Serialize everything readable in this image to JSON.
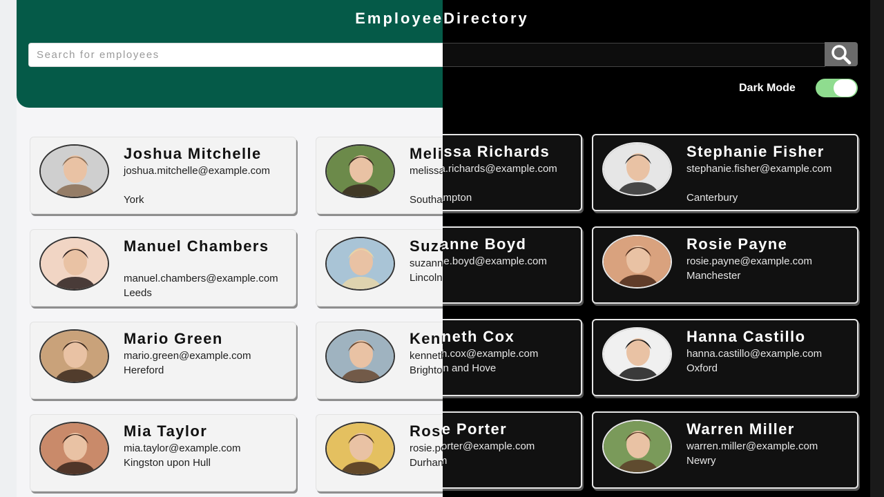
{
  "app": {
    "title_left": "Employee",
    "title_right": "Directory",
    "dark_mode_label": "Dark Mode",
    "dark_mode_on": true
  },
  "search": {
    "placeholder": "Search for employees",
    "icon": "search-icon"
  },
  "colors": {
    "header_green": "#055a48",
    "toggle_green": "#8fdc8f",
    "dark_bg": "#000000"
  },
  "employees": [
    {
      "name": "Joshua Mitchelle",
      "email": "joshua.mitchelle@example.com",
      "city": "York"
    },
    {
      "name": "Melissa Richards",
      "email": "melissa.richards@example.com",
      "city": "Southampton"
    },
    {
      "name": "Stephanie Fisher",
      "email": "stephanie.fisher@example.com",
      "city": "Canterbury"
    },
    {
      "name": "Manuel Chambers",
      "email": "manuel.chambers@example.com",
      "city": "Leeds"
    },
    {
      "name": "Suzanne Boyd",
      "email": "suzanne.boyd@example.com",
      "city": "Lincoln"
    },
    {
      "name": "Rosie Payne",
      "email": "rosie.payne@example.com",
      "city": "Manchester"
    },
    {
      "name": "Mario Green",
      "email": "mario.green@example.com",
      "city": "Hereford"
    },
    {
      "name": "Kenneth Cox",
      "email": "kenneth.cox@example.com",
      "city": "Brighton and Hove"
    },
    {
      "name": "Hanna Castillo",
      "email": "hanna.castillo@example.com",
      "city": "Oxford"
    },
    {
      "name": "Mia Taylor",
      "email": "mia.taylor@example.com",
      "city": "Kingston upon Hull"
    },
    {
      "name": "Rose Porter",
      "email": "rosie.porter@example.com",
      "city": "Durham"
    },
    {
      "name": "Warren Miller",
      "email": "warren.miller@example.com",
      "city": "Newry"
    }
  ]
}
